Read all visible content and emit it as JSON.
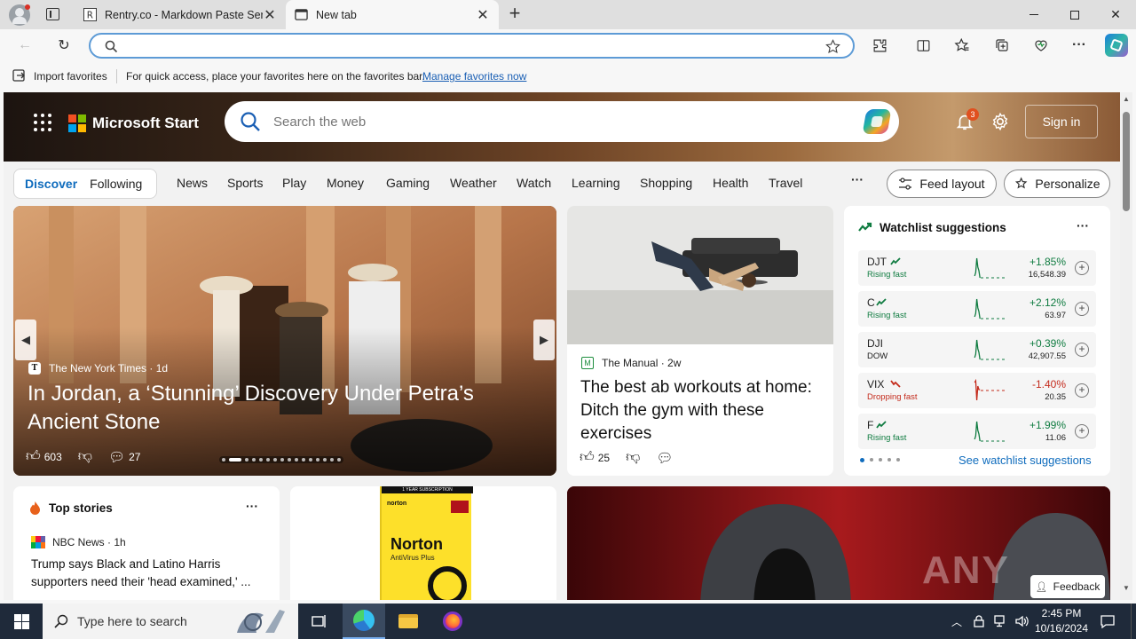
{
  "browser": {
    "tabs": [
      {
        "title": "Rentry.co - Markdown Paste Servi",
        "active": false
      },
      {
        "title": "New tab",
        "active": true
      }
    ],
    "address": {
      "value": "",
      "placeholder": ""
    },
    "favorites_bar": {
      "import_label": "Import favorites",
      "message": "For quick access, place your favorites here on the favorites bar.",
      "manage_link": "Manage favorites now"
    }
  },
  "msn": {
    "brand": "Microsoft Start",
    "search_placeholder": "Search the web",
    "notification_count": "3",
    "signin_label": "Sign in",
    "nav": {
      "discover": "Discover",
      "following": "Following",
      "links": [
        "News",
        "Sports",
        "Play",
        "Money",
        "Gaming",
        "Weather",
        "Watch",
        "Learning",
        "Shopping",
        "Health",
        "Travel"
      ],
      "more": "···",
      "feed_layout": "Feed layout",
      "personalize": "Personalize"
    },
    "hero": {
      "source": "The New York Times",
      "age": "1d",
      "headline": "In Jordan, a ‘Stunning’ Discovery Under Petra’s Ancient Stone",
      "likes": "603",
      "comments": "27",
      "carousel_count": 16,
      "carousel_active": 1
    },
    "article2": {
      "source": "The Manual",
      "age": "2w",
      "headline": "The best ab workouts at home: Ditch the gym with these exercises",
      "likes": "25"
    },
    "watchlist": {
      "title": "Watchlist suggestions",
      "more": "···",
      "rows": [
        {
          "symbol": "DJT",
          "status": "Rising fast",
          "change": "+1.85%",
          "price": "16,548.39",
          "dir": "up"
        },
        {
          "symbol": "C",
          "status": "Rising fast",
          "change": "+2.12%",
          "price": "63.97",
          "dir": "up"
        },
        {
          "symbol": "DJI",
          "status": "DOW",
          "change": "+0.39%",
          "price": "42,907.55",
          "dir": "up"
        },
        {
          "symbol": "VIX",
          "status": "Dropping fast",
          "change": "-1.40%",
          "price": "20.35",
          "dir": "down"
        },
        {
          "symbol": "F",
          "status": "Rising fast",
          "change": "+1.99%",
          "price": "11.06",
          "dir": "up"
        }
      ],
      "see_more": "See watchlist suggestions"
    },
    "top_stories": {
      "title": "Top stories",
      "more": "···",
      "source": "NBC News",
      "age": "1h",
      "headline": "Trump says Black and Latino Harris supporters need their 'head examined,' ..."
    },
    "ad": {
      "badge": "1 YEAR SUBSCRIPTION",
      "brand_small": "norton",
      "brand": "Norton",
      "product": "AntiVirus Plus"
    },
    "feedback_label": "Feedback",
    "watermark": "ANY RUN"
  },
  "taskbar": {
    "search_placeholder": "Type here to search",
    "time": "2:45 PM",
    "date": "10/16/2024"
  },
  "colors": {
    "accent": "#0f6cbd",
    "up": "#107c41",
    "down": "#c42b1c",
    "taskbar": "#1f2a3a"
  }
}
